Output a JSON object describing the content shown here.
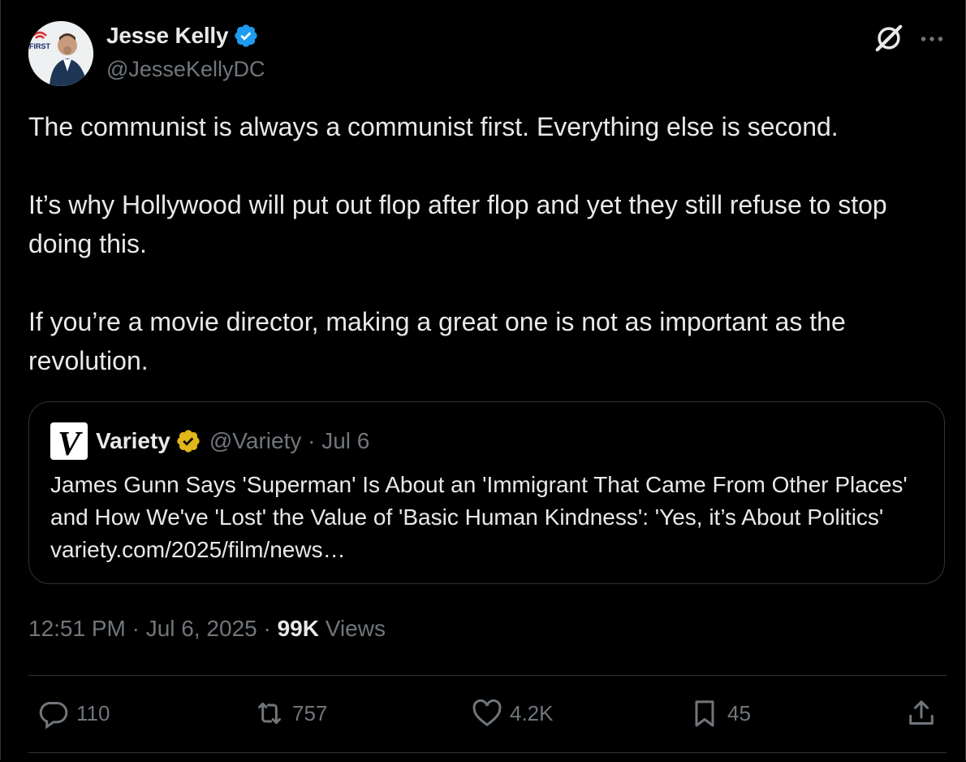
{
  "author": {
    "name": "Jesse Kelly",
    "handle": "@JesseKellyDC",
    "avatar_badge": "FIRST",
    "verified_color": "#1d9bf0"
  },
  "icons": {
    "verified": "verified-check-icon",
    "grok": "grok-icon",
    "more": "more-dots-icon",
    "reply": "reply-icon",
    "repost": "repost-icon",
    "like": "heart-icon",
    "bookmark": "bookmark-icon",
    "share": "share-icon"
  },
  "tweet": {
    "paragraphs": [
      "The communist is always a communist first. Everything else is second.",
      "It’s why Hollywood will put out flop after flop and yet they still refuse to stop doing this.",
      "If you’re a movie director, making a great one is not as important as the revolution."
    ]
  },
  "quote": {
    "logo_letter": "V",
    "name": "Variety",
    "badge_color": "#e2b719",
    "meta": "@Variety · Jul 6",
    "text": "James Gunn Says 'Superman' Is About an 'Immigrant That Came From Other Places' and How We've 'Lost' the Value of 'Basic Human Kindness': 'Yes, it’s About Politics' variety.com/2025/film/news…"
  },
  "timestamp": {
    "time_date": "12:51 PM · Jul 6, 2025 · ",
    "views_count": "99K",
    "views_label": " Views"
  },
  "actions": {
    "replies": "110",
    "reposts": "757",
    "likes": "4.2K",
    "bookmarks": "45"
  }
}
